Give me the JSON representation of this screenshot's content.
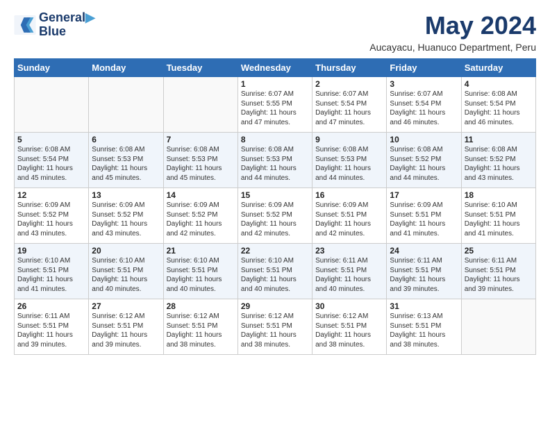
{
  "logo": {
    "line1": "General",
    "line2": "Blue"
  },
  "title": "May 2024",
  "location": "Aucayacu, Huanuco Department, Peru",
  "days_header": [
    "Sunday",
    "Monday",
    "Tuesday",
    "Wednesday",
    "Thursday",
    "Friday",
    "Saturday"
  ],
  "weeks": [
    [
      {
        "day": "",
        "info": ""
      },
      {
        "day": "",
        "info": ""
      },
      {
        "day": "",
        "info": ""
      },
      {
        "day": "1",
        "info": "Sunrise: 6:07 AM\nSunset: 5:55 PM\nDaylight: 11 hours and 47 minutes."
      },
      {
        "day": "2",
        "info": "Sunrise: 6:07 AM\nSunset: 5:54 PM\nDaylight: 11 hours and 47 minutes."
      },
      {
        "day": "3",
        "info": "Sunrise: 6:07 AM\nSunset: 5:54 PM\nDaylight: 11 hours and 46 minutes."
      },
      {
        "day": "4",
        "info": "Sunrise: 6:08 AM\nSunset: 5:54 PM\nDaylight: 11 hours and 46 minutes."
      }
    ],
    [
      {
        "day": "5",
        "info": "Sunrise: 6:08 AM\nSunset: 5:54 PM\nDaylight: 11 hours and 45 minutes."
      },
      {
        "day": "6",
        "info": "Sunrise: 6:08 AM\nSunset: 5:53 PM\nDaylight: 11 hours and 45 minutes."
      },
      {
        "day": "7",
        "info": "Sunrise: 6:08 AM\nSunset: 5:53 PM\nDaylight: 11 hours and 45 minutes."
      },
      {
        "day": "8",
        "info": "Sunrise: 6:08 AM\nSunset: 5:53 PM\nDaylight: 11 hours and 44 minutes."
      },
      {
        "day": "9",
        "info": "Sunrise: 6:08 AM\nSunset: 5:53 PM\nDaylight: 11 hours and 44 minutes."
      },
      {
        "day": "10",
        "info": "Sunrise: 6:08 AM\nSunset: 5:52 PM\nDaylight: 11 hours and 44 minutes."
      },
      {
        "day": "11",
        "info": "Sunrise: 6:08 AM\nSunset: 5:52 PM\nDaylight: 11 hours and 43 minutes."
      }
    ],
    [
      {
        "day": "12",
        "info": "Sunrise: 6:09 AM\nSunset: 5:52 PM\nDaylight: 11 hours and 43 minutes."
      },
      {
        "day": "13",
        "info": "Sunrise: 6:09 AM\nSunset: 5:52 PM\nDaylight: 11 hours and 43 minutes."
      },
      {
        "day": "14",
        "info": "Sunrise: 6:09 AM\nSunset: 5:52 PM\nDaylight: 11 hours and 42 minutes."
      },
      {
        "day": "15",
        "info": "Sunrise: 6:09 AM\nSunset: 5:52 PM\nDaylight: 11 hours and 42 minutes."
      },
      {
        "day": "16",
        "info": "Sunrise: 6:09 AM\nSunset: 5:51 PM\nDaylight: 11 hours and 42 minutes."
      },
      {
        "day": "17",
        "info": "Sunrise: 6:09 AM\nSunset: 5:51 PM\nDaylight: 11 hours and 41 minutes."
      },
      {
        "day": "18",
        "info": "Sunrise: 6:10 AM\nSunset: 5:51 PM\nDaylight: 11 hours and 41 minutes."
      }
    ],
    [
      {
        "day": "19",
        "info": "Sunrise: 6:10 AM\nSunset: 5:51 PM\nDaylight: 11 hours and 41 minutes."
      },
      {
        "day": "20",
        "info": "Sunrise: 6:10 AM\nSunset: 5:51 PM\nDaylight: 11 hours and 40 minutes."
      },
      {
        "day": "21",
        "info": "Sunrise: 6:10 AM\nSunset: 5:51 PM\nDaylight: 11 hours and 40 minutes."
      },
      {
        "day": "22",
        "info": "Sunrise: 6:10 AM\nSunset: 5:51 PM\nDaylight: 11 hours and 40 minutes."
      },
      {
        "day": "23",
        "info": "Sunrise: 6:11 AM\nSunset: 5:51 PM\nDaylight: 11 hours and 40 minutes."
      },
      {
        "day": "24",
        "info": "Sunrise: 6:11 AM\nSunset: 5:51 PM\nDaylight: 11 hours and 39 minutes."
      },
      {
        "day": "25",
        "info": "Sunrise: 6:11 AM\nSunset: 5:51 PM\nDaylight: 11 hours and 39 minutes."
      }
    ],
    [
      {
        "day": "26",
        "info": "Sunrise: 6:11 AM\nSunset: 5:51 PM\nDaylight: 11 hours and 39 minutes."
      },
      {
        "day": "27",
        "info": "Sunrise: 6:12 AM\nSunset: 5:51 PM\nDaylight: 11 hours and 39 minutes."
      },
      {
        "day": "28",
        "info": "Sunrise: 6:12 AM\nSunset: 5:51 PM\nDaylight: 11 hours and 38 minutes."
      },
      {
        "day": "29",
        "info": "Sunrise: 6:12 AM\nSunset: 5:51 PM\nDaylight: 11 hours and 38 minutes."
      },
      {
        "day": "30",
        "info": "Sunrise: 6:12 AM\nSunset: 5:51 PM\nDaylight: 11 hours and 38 minutes."
      },
      {
        "day": "31",
        "info": "Sunrise: 6:13 AM\nSunset: 5:51 PM\nDaylight: 11 hours and 38 minutes."
      },
      {
        "day": "",
        "info": ""
      }
    ]
  ]
}
